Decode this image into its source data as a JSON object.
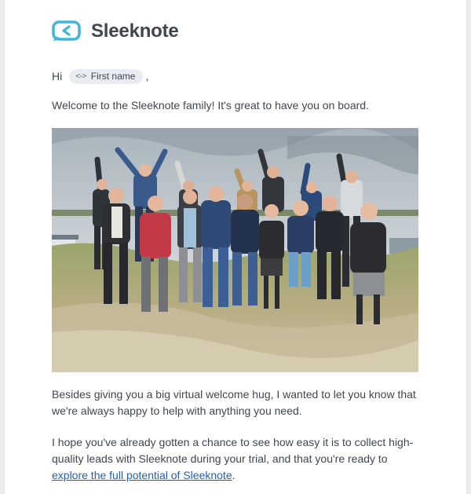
{
  "brand": {
    "name": "Sleeknote",
    "accent": "#3fb6d8",
    "text_color": "#3f4650",
    "link_color": "#1f5fbf"
  },
  "greeting": {
    "hi": "Hi",
    "merge_tag_icon": "<->",
    "merge_tag_label": "First name",
    "comma": ","
  },
  "body": {
    "welcome": "Welcome to the Sleeknote family! It's great to have you on board.",
    "para2": "Besides giving you a big virtual welcome hug, I wanted to let you know that we're always happy to help with anything you need.",
    "para3_before": "I hope you've already gotten a chance to see how easy it is to collect high-quality leads with Sleeknote during your trial, and that you're ready to ",
    "para3_link": "explore the full potential of Sleeknote",
    "para3_after": "."
  },
  "image": {
    "icon": "team-photo"
  }
}
